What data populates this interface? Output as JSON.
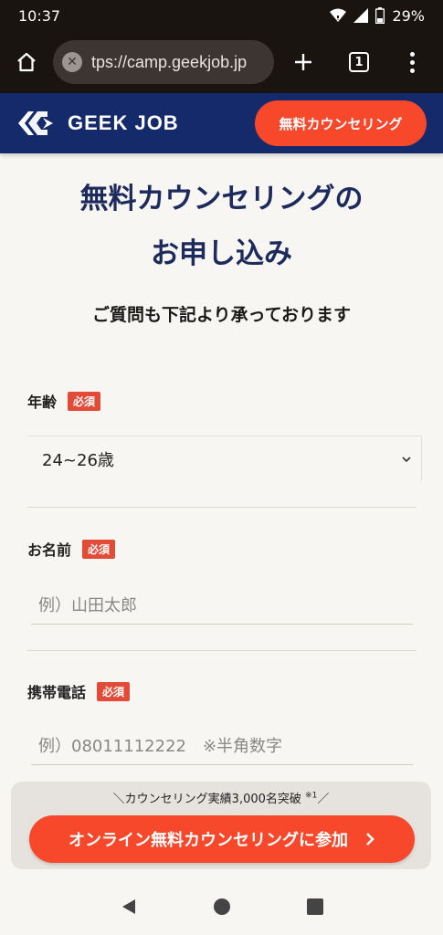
{
  "status": {
    "time": "10:37",
    "battery": "29%"
  },
  "browser": {
    "url": "tps://camp.geekjob.jp",
    "tab_count": "1"
  },
  "header": {
    "logo_text": "GEEK JOB",
    "cta_label": "無料カウンセリング"
  },
  "page": {
    "title_line1": "無料カウンセリングの",
    "title_line2": "お申し込み",
    "subtitle": "ご質問も下記より承っております"
  },
  "form": {
    "required_badge": "必須",
    "age": {
      "label": "年齢",
      "value": "24~26歳"
    },
    "name": {
      "label": "お名前",
      "placeholder": "例）山田太郎"
    },
    "phone": {
      "label": "携帯電話",
      "placeholder": "例）08011112222　※半角数字"
    }
  },
  "floating_cta": {
    "caption": "＼カウンセリング実績3,000名突破",
    "caption_note": "※1",
    "caption_end": "／",
    "button_label": "オンライン無料カウンセリングに参加"
  },
  "colors": {
    "brand_navy": "#142a6b",
    "accent_orange": "#f7482c",
    "required_red": "#e34b39"
  }
}
